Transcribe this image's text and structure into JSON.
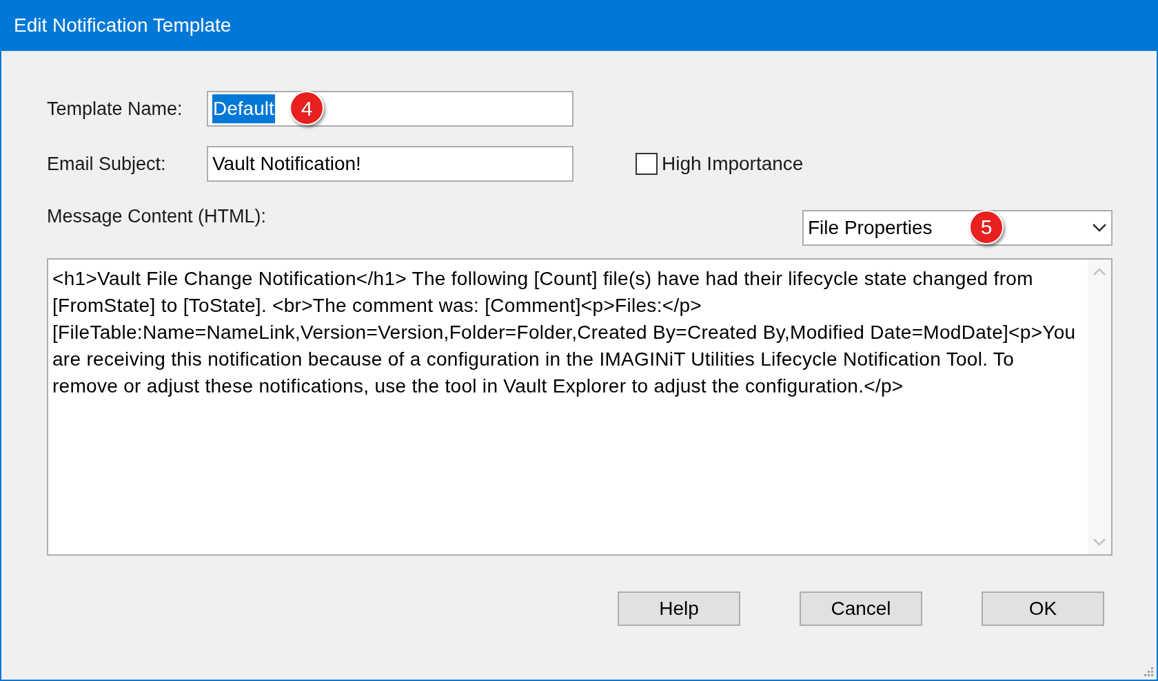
{
  "window": {
    "title": "Edit Notification Template"
  },
  "template_name": {
    "label": "Template Name:",
    "value": "Default",
    "value_highlighted": true,
    "callout": "4"
  },
  "email_subject": {
    "label": "Email Subject:",
    "value": "Vault Notification!"
  },
  "high_importance": {
    "label": "High Importance",
    "checked": false
  },
  "message_content": {
    "label": "Message Content (HTML):",
    "value": "<h1>Vault File Change Notification</h1> The following [Count] file(s) have had their lifecycle state changed from [FromState] to [ToState]. <br>The comment was: [Comment]<p>Files:</p> [FileTable:Name=NameLink,Version=Version,Folder=Folder,Created By=Created By,Modified Date=ModDate]<p>You are receiving this notification because of a configuration in the IMAGINiT Utilities Lifecycle Notification Tool. To remove or adjust these notifications, use the tool in Vault Explorer to adjust the configuration.</p>"
  },
  "properties_dropdown": {
    "value": "File Properties",
    "callout": "5"
  },
  "buttons": [
    "Help",
    "Cancel",
    "OK"
  ]
}
